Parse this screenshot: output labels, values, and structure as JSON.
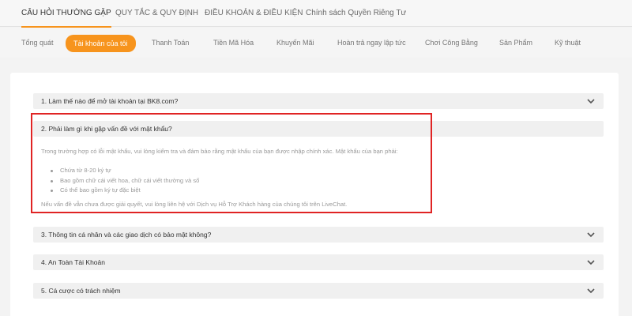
{
  "top_tabs": [
    {
      "label": "CÂU HỎI THƯỜNG GẶP",
      "active": true
    },
    {
      "label": "QUY TẮC & QUY ĐỊNH",
      "active": false
    },
    {
      "label": "ĐIỀU KHOẢN & ĐIỀU KIỆN",
      "active": false
    },
    {
      "label": "Chính sách Quyền Riêng Tư",
      "active": false
    }
  ],
  "sub_tabs": [
    {
      "label": "Tổng quát",
      "active": false
    },
    {
      "label": "Tài khoản của tôi",
      "active": true
    },
    {
      "label": "Thanh Toán",
      "active": false
    },
    {
      "label": "Tiền Mã Hóa",
      "active": false
    },
    {
      "label": "Khuyến Mãi",
      "active": false
    },
    {
      "label": "Hoàn trả ngay lập tức",
      "active": false
    },
    {
      "label": "Chơi Công Bằng",
      "active": false
    },
    {
      "label": "Sản Phẩm",
      "active": false
    },
    {
      "label": "Kỹ thuật",
      "active": false
    }
  ],
  "faqs": [
    {
      "question": "1. Làm thế nào để mở tài khoản tại BK8.com?",
      "expanded": false
    },
    {
      "question": "2. Phải làm gì khi gặp vấn đề với mật khẩu?",
      "expanded": true
    },
    {
      "question": "3. Thông tin cá nhân và các giao dịch có bảo mật không?",
      "expanded": false
    },
    {
      "question": "4. An Toàn Tài Khoản",
      "expanded": false
    },
    {
      "question": "5. Cá cược có trách nhiệm",
      "expanded": false
    }
  ],
  "answer": {
    "intro": "Trong trường hợp có lỗi mật khẩu, vui lòng kiểm tra và đảm bảo rằng mật khẩu của bạn được nhập chính xác. Mật khẩu của bạn phải:",
    "bullets": [
      "Chứa từ 8-20 ký tự",
      "Bao gồm chữ cái viết hoa, chữ cái viết thường và số",
      "Có thể bao gồm ký tự đặc biệt"
    ],
    "outro": "Nếu vấn đề vẫn chưa được giải quyết, vui lòng liên hệ với Dịch vụ Hỗ Trợ Khách hàng của chúng tôi trên LiveChat."
  },
  "colors": {
    "accent": "#f7941d",
    "highlight_border": "#e02424",
    "answer_text": "#9a9a9a"
  },
  "icons": {
    "collapsed": "chevron-down-icon",
    "expanded": "chevron-down-icon"
  }
}
